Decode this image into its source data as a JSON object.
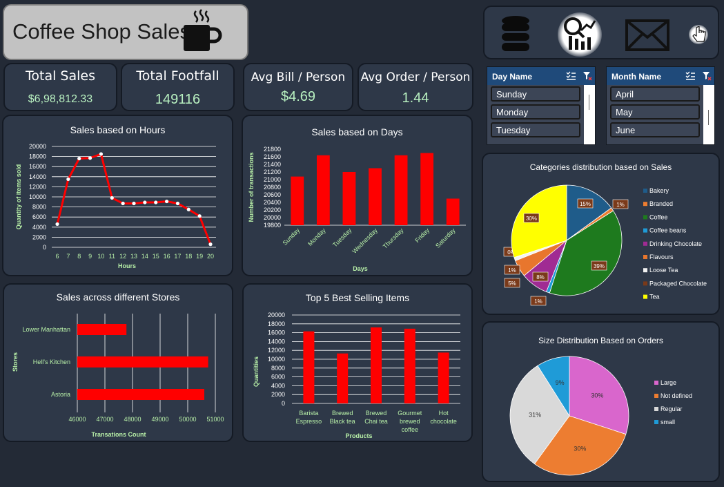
{
  "header": {
    "title": "Coffee Shop Sales"
  },
  "kpis": [
    {
      "label": "Total Sales",
      "value": "$6,98,812.33"
    },
    {
      "label": "Total Footfall",
      "value": "149116"
    },
    {
      "label": "Avg Bill / Person",
      "value": "$4.69"
    },
    {
      "label": "Avg Order / Person",
      "value": "1.44"
    }
  ],
  "nav": {
    "icons": [
      "database-icon",
      "analytics-icon",
      "mail-icon",
      "pointer-hand-icon"
    ]
  },
  "slicers": {
    "day": {
      "title": "Day Name",
      "items": [
        "Sunday",
        "Monday",
        "Tuesday"
      ]
    },
    "month": {
      "title": "Month Name",
      "items": [
        "April",
        "May",
        "June"
      ]
    }
  },
  "chart_data": [
    {
      "type": "line",
      "title": "Sales based on Hours",
      "xlabel": "Hours",
      "ylabel": "Quantity of items sold",
      "x": [
        6,
        7,
        8,
        9,
        10,
        11,
        12,
        13,
        14,
        15,
        16,
        17,
        18,
        19,
        20
      ],
      "values": [
        4600,
        13500,
        17600,
        17700,
        18500,
        9800,
        8700,
        8700,
        8900,
        8900,
        9100,
        8700,
        7500,
        6200,
        600
      ],
      "yticks": [
        "0",
        "2000",
        "4000",
        "6000",
        "8000",
        "10000",
        "12000",
        "14000",
        "16000",
        "18000",
        "20000"
      ],
      "ylim": [
        0,
        20000
      ],
      "color": "#ff0000"
    },
    {
      "type": "bar",
      "title": "Sales based on Days",
      "xlabel": "Days",
      "ylabel": "Number of transactions",
      "categories": [
        "Sunday",
        "Monday",
        "Tuesday",
        "Wednesday",
        "Thursday",
        "Friday",
        "Saturday"
      ],
      "values": [
        21080,
        21640,
        21200,
        21300,
        21640,
        21700,
        20500
      ],
      "yticks": [
        "19800",
        "20000",
        "20200",
        "20400",
        "20600",
        "20800",
        "21000",
        "21200",
        "21400",
        "21600",
        "21800"
      ],
      "ylim": [
        19800,
        21800
      ],
      "color": "#ff0000"
    },
    {
      "type": "bar",
      "orientation": "horizontal",
      "title": "Sales across different Stores",
      "xlabel": "Transations Count",
      "ylabel": "Stores",
      "categories": [
        "Lower Manhattan",
        "Hell's Kitchen",
        "Astoria"
      ],
      "values": [
        47780,
        50740,
        50600
      ],
      "xticks": [
        "46000",
        "47000",
        "48000",
        "49000",
        "50000",
        "51000"
      ],
      "xlim": [
        46000,
        51000
      ],
      "color": "#ff0000"
    },
    {
      "type": "bar",
      "title": "Top 5 Best Selling Items",
      "xlabel": "Products",
      "ylabel": "Quantities",
      "categories": [
        [
          "Barista",
          "Espresso"
        ],
        [
          "Brewed",
          "Black tea"
        ],
        [
          "Brewed",
          "Chai tea"
        ],
        [
          "Gourmet",
          "brewed",
          "coffee"
        ],
        [
          "Hot",
          "chocolate"
        ]
      ],
      "values": [
        16300,
        11300,
        17200,
        16900,
        11500
      ],
      "yticks": [
        "0",
        "2000",
        "4000",
        "6000",
        "8000",
        "10000",
        "12000",
        "14000",
        "16000",
        "18000",
        "20000"
      ],
      "ylim": [
        0,
        20000
      ],
      "color": "#ff0000"
    },
    {
      "type": "pie",
      "title": "Categories distribution based on Sales",
      "labels": [
        "Bakery",
        "Branded",
        "Coffee",
        "Coffee beans",
        "Drinking Chocolate",
        "Flavours",
        "Loose Tea",
        "Packaged Chocolate",
        "Tea"
      ],
      "values": [
        15,
        1,
        39,
        1,
        8,
        5,
        1,
        0,
        30
      ],
      "data_labels": [
        "15%",
        "1%",
        "39%",
        "1%",
        "8%",
        "5%",
        "1%",
        "0%",
        "30%"
      ],
      "colors": [
        "#1f5c8a",
        "#ed7d31",
        "#1e7a1e",
        "#1f9bd7",
        "#a02b93",
        "#e8762d",
        "#f2f2f2",
        "#7a3a1a",
        "#ffff00"
      ]
    },
    {
      "type": "pie",
      "title": "Size Distribution Based on Orders",
      "labels": [
        "Large",
        "Not defined",
        "Regular",
        "small"
      ],
      "values": [
        30,
        30,
        31,
        9
      ],
      "data_labels": [
        "30%",
        "30%",
        "31%",
        "9%"
      ],
      "colors": [
        "#d966cc",
        "#ed7d31",
        "#d9d9d9",
        "#1f9bd7"
      ]
    }
  ]
}
